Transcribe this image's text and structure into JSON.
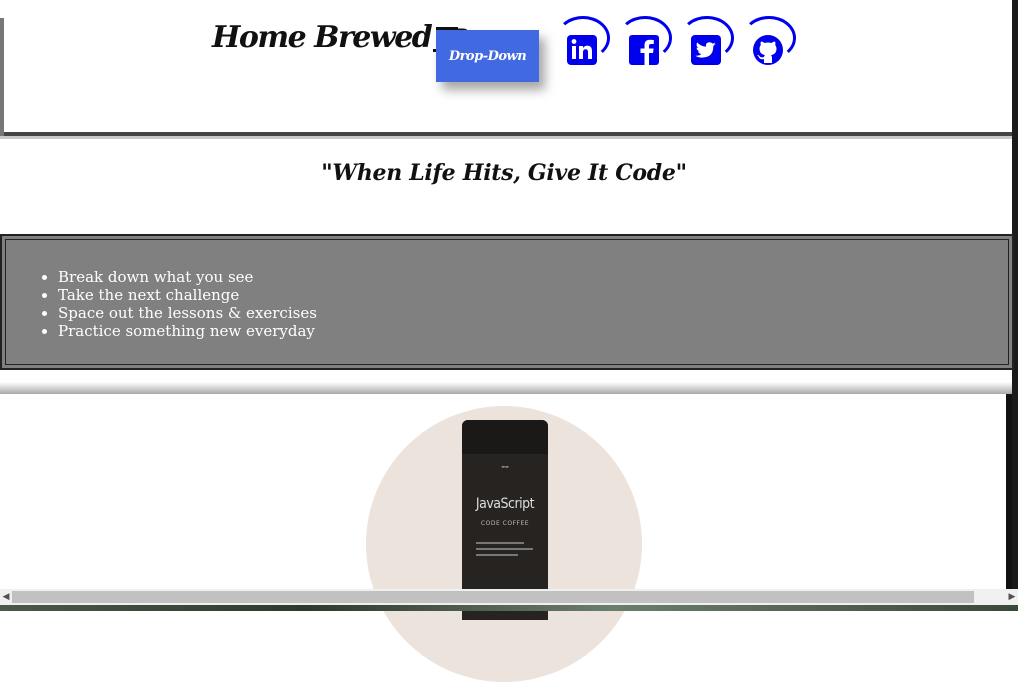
{
  "header": {
    "brand_text": "Home Brewed",
    "dropdown_label": "Drop-Down",
    "social_links": [
      {
        "name": "linkedin",
        "icon": "linkedin-icon"
      },
      {
        "name": "facebook",
        "icon": "facebook-icon"
      },
      {
        "name": "twitter",
        "icon": "twitter-icon"
      },
      {
        "name": "github",
        "icon": "github-icon"
      }
    ]
  },
  "tagline": "\"When Life Hits, Give It Code\"",
  "tips": [
    "Break down what you see",
    "Take the next challenge",
    "Space out the lessons & exercises",
    "Practice something new everyday"
  ],
  "product": {
    "bag_title": "JavaScript",
    "bag_subtitle": "CODE COFFEE"
  },
  "colors": {
    "accent_button": "#4169e1",
    "social_link": "#0000ee",
    "list_background": "#808080"
  }
}
